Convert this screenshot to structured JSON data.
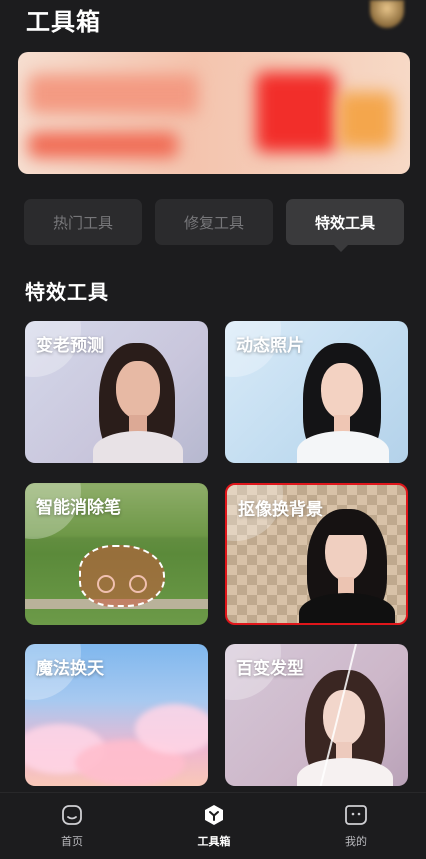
{
  "header": {
    "title": "工具箱"
  },
  "tabs": [
    {
      "label": "热门工具",
      "active": false
    },
    {
      "label": "修复工具",
      "active": false
    },
    {
      "label": "特效工具",
      "active": true
    }
  ],
  "section": {
    "title": "特效工具"
  },
  "cards": [
    {
      "label": "变老预测",
      "icon": "aging-portrait"
    },
    {
      "label": "动态照片",
      "icon": "motion-portrait"
    },
    {
      "label": "智能消除笔",
      "icon": "eraser-scene"
    },
    {
      "label": "抠像换背景",
      "icon": "cutout-portrait",
      "highlighted": true
    },
    {
      "label": "魔法换天",
      "icon": "sky-scene"
    },
    {
      "label": "百变发型",
      "icon": "hairstyle-portrait"
    }
  ],
  "bottom_nav": [
    {
      "label": "首页",
      "icon": "home-icon",
      "active": false
    },
    {
      "label": "工具箱",
      "icon": "toolbox-icon",
      "active": true
    },
    {
      "label": "我的",
      "icon": "profile-icon",
      "active": false
    }
  ],
  "colors": {
    "background": "#1c1c1e",
    "highlight_border": "#e0161b",
    "tab_active": "#3a3a3c",
    "tab_inactive": "#2b2b2d"
  }
}
